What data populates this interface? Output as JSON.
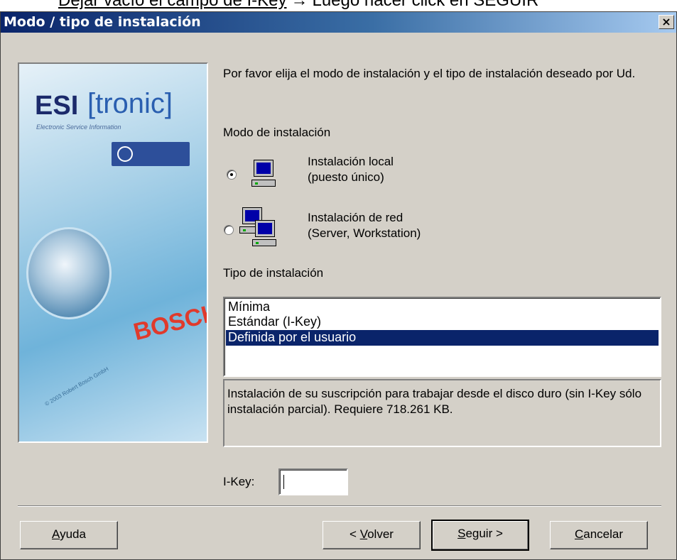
{
  "caption": {
    "underlined_text": "Dejar vacío el campo de I-Key",
    "arrow": "→",
    "rest_text": "Luego hacer click en SEGUIR"
  },
  "window": {
    "title": "Modo / tipo de instalación",
    "close_glyph": "×"
  },
  "banner": {
    "logo_esi": "ESI",
    "logo_tronic": "[tronic]",
    "logo_subtitle": "Electronic Service Information",
    "brand": "BOSCH",
    "copyright": "© 2003 Robert Bosch GmbH"
  },
  "intro_text": "Por favor elija el modo de instalación y el tipo de instalación deseado por Ud.",
  "mode": {
    "label": "Modo de instalación",
    "options": [
      {
        "line1": "Instalación local",
        "line2": "(puesto único)",
        "checked": true,
        "icon": "single-computer-icon"
      },
      {
        "line1": "Instalación de red",
        "line2": "(Server, Workstation)",
        "checked": false,
        "icon": "network-computers-icon"
      }
    ]
  },
  "type": {
    "label": "Tipo de instalación",
    "items": [
      "Mínima",
      "Estándar (I-Key)",
      "Definida por el usuario"
    ],
    "selected_index": 2
  },
  "description": "Instalación de su suscripción para trabajar desde el disco duro (sin I-Key sólo instalación parcial). Requiere 718.261 KB.",
  "ikey": {
    "label": "I-Key:",
    "value": ""
  },
  "buttons": {
    "help": {
      "first": "A",
      "rest": "yuda"
    },
    "back": {
      "prefix": "< ",
      "first": "V",
      "rest": "olver"
    },
    "next": {
      "first": "S",
      "rest": "eguir >"
    },
    "cancel": {
      "first": "C",
      "rest": "ancelar"
    }
  },
  "colors": {
    "title_gradient_start": "#0a246a",
    "selection": "#0a246a",
    "dialog_face": "#d4d0c8"
  }
}
